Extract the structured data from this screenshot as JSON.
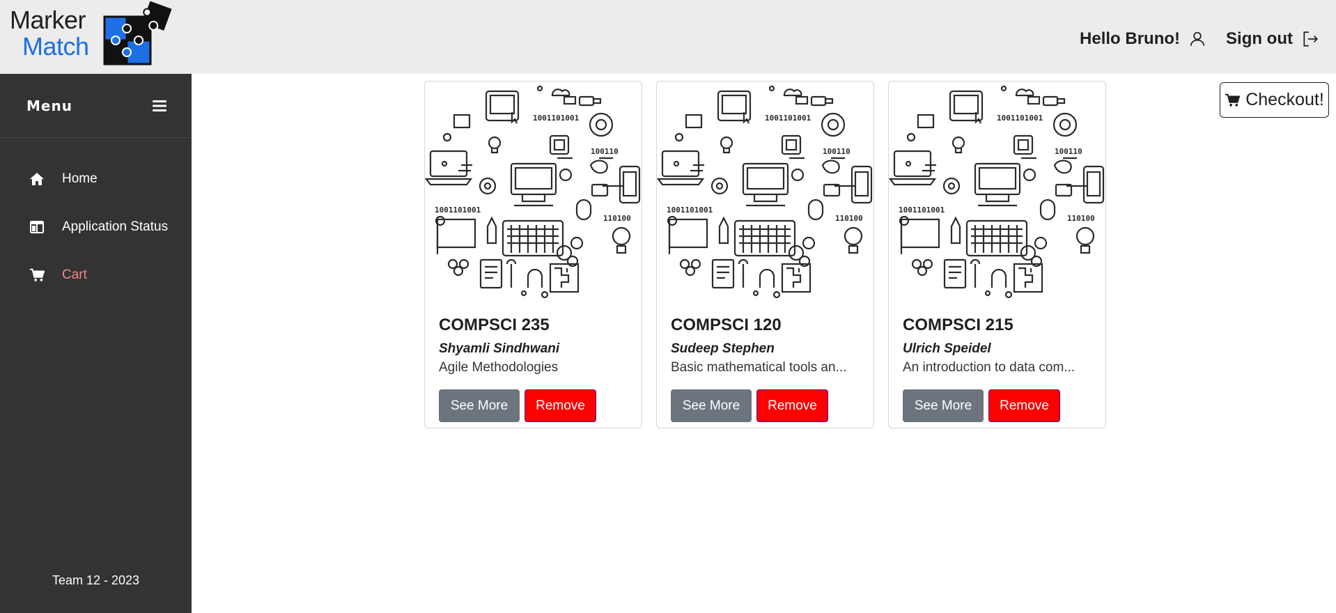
{
  "header": {
    "logo_line1": "Marker",
    "logo_line2": "Match",
    "greeting": "Hello Bruno!",
    "signout_label": "Sign out",
    "user_icon": "user-icon",
    "signout_icon": "sign-out-icon"
  },
  "sidebar": {
    "menu_title": "Menu",
    "menu_icon": "hamburger-icon",
    "items": [
      {
        "label": "Home",
        "icon": "home-icon",
        "active": false
      },
      {
        "label": "Application Status",
        "icon": "columns-icon",
        "active": false
      },
      {
        "label": "Cart",
        "icon": "cart-icon",
        "active": true
      }
    ],
    "footer": "Team 12 - 2023"
  },
  "checkout": {
    "label": "Checkout!",
    "icon": "cart-icon"
  },
  "cards": [
    {
      "title": "COMPSCI 235",
      "author": "Shyamli Sindhwani",
      "description": "Agile Methodologies",
      "see_more": "See More",
      "remove": "Remove"
    },
    {
      "title": "COMPSCI 120",
      "author": "Sudeep Stephen",
      "description": "Basic mathematical tools an...",
      "see_more": "See More",
      "remove": "Remove"
    },
    {
      "title": "COMPSCI 215",
      "author": "Ulrich Speidel",
      "description": "An introduction to data com...",
      "see_more": "See More",
      "remove": "Remove"
    }
  ],
  "card_image_text": {
    "binary_top": "1001101001",
    "binary_mid": "100110",
    "binary_left": "1001101001",
    "binary_right": "110100"
  },
  "colors": {
    "header_bg": "#ececec",
    "sidebar_bg": "#333333",
    "active_nav": "#f08a8a",
    "logo_blue": "#1d6fe5",
    "remove_btn": "#ff0000",
    "see_more_btn": "#6c757d"
  }
}
